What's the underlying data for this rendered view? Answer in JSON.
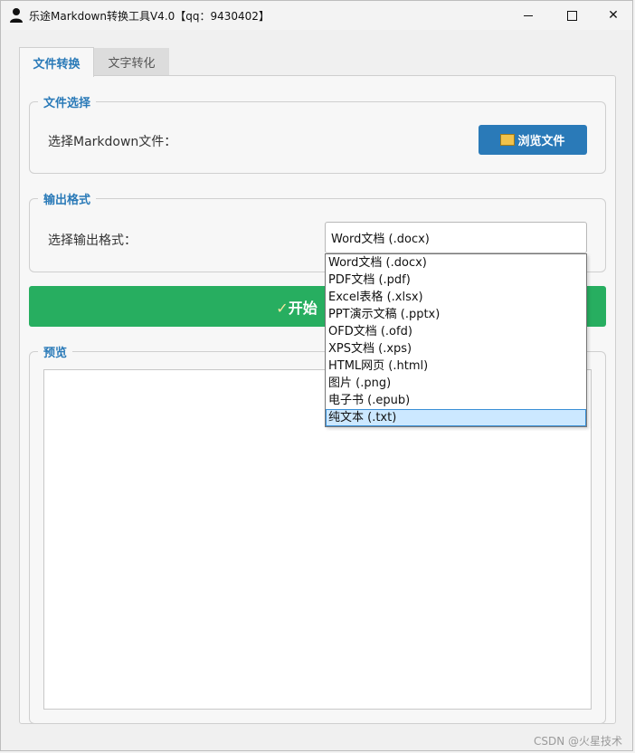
{
  "window": {
    "title": "乐途Markdown转换工具V4.0【qq：9430402】",
    "minimize_glyph": "—",
    "maximize_glyph": "☐",
    "close_glyph": "✕"
  },
  "tabs": [
    {
      "label": "文件转换",
      "active": true
    },
    {
      "label": "文字转化",
      "active": false
    }
  ],
  "file_group": {
    "title": "文件选择",
    "label": "选择Markdown文件：",
    "browse_label": "浏览文件",
    "browse_icon": "folder-icon"
  },
  "output_group": {
    "title": "输出格式",
    "label": "选择输出格式：",
    "selected": "Word文档 (.docx)",
    "options": [
      "Word文档 (.docx)",
      "PDF文档 (.pdf)",
      "Excel表格 (.xlsx)",
      "PPT演示文稿 (.pptx)",
      "OFD文档 (.ofd)",
      "XPS文档 (.xps)",
      "HTML网页 (.html)",
      "图片 (.png)",
      "电子书 (.epub)",
      "纯文本 (.txt)"
    ],
    "highlighted_index": 9
  },
  "start_button": {
    "check": "✓",
    "label": "开始"
  },
  "preview_group": {
    "title": "预览",
    "content": ""
  },
  "watermark": "CSDN @火星技术",
  "colors": {
    "accent": "#2a7ab8",
    "start": "#27ae60",
    "highlight": "#cce8ff"
  }
}
